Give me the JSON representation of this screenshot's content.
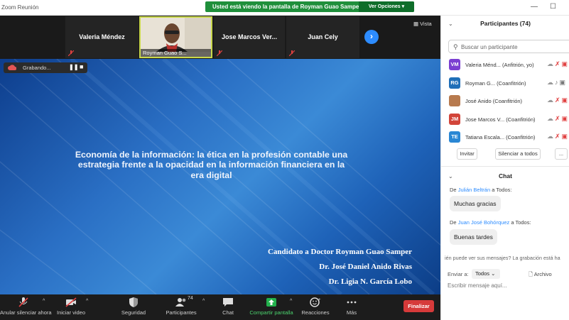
{
  "window": {
    "title": "Zoom Reunión",
    "share_banner": "Usted está viendo la pantalla de Royman Guao Samper",
    "view_options": "Ver Opciones",
    "minimize": "—",
    "maximize": "☐"
  },
  "gallery": {
    "tiles": [
      {
        "name": "Valeria Méndez"
      },
      {
        "name": "Royman Guao S..."
      },
      {
        "name": "Jose Marcos Ver..."
      },
      {
        "name": "Juan Cely"
      }
    ],
    "view_label": "Vista"
  },
  "recording": {
    "label": "Grabando..."
  },
  "slide": {
    "title_lines": [
      "Economía de la información: la ética en la profesión contable una",
      "estrategia frente a la opacidad en la información financiera en la",
      "era digital"
    ],
    "authors": [
      "Candidato a Doctor Royman Guao Samper",
      "Dr. José Daniel Anido Rivas",
      "Dr. Ligia N. García Lobo"
    ]
  },
  "toolbar": {
    "mute": "Anular silenciar ahora",
    "video": "Iniciar video",
    "security": "Seguridad",
    "participants": "Participantes",
    "participants_count": "74",
    "chat": "Chat",
    "share": "Compartir pantalla",
    "reactions": "Reacciones",
    "more": "Más",
    "end": "Finalizar"
  },
  "participants_panel": {
    "header": "Participantes (74)",
    "search_placeholder": "Buscar un participante",
    "people": [
      {
        "initials": "VM",
        "name": "Valeria Ménd...  (Anfitrión, yo)",
        "color": "#7b3fd1"
      },
      {
        "initials": "RG",
        "name": "Royman G...  (Coanfitrión)",
        "color": "#1f6fb8"
      },
      {
        "initials": "",
        "name": "José Anido  (Coanfitrión)",
        "color": "#b77a4e"
      },
      {
        "initials": "JM",
        "name": "Jose Marcos V...  (Coanfitrión)",
        "color": "#d2453a"
      },
      {
        "initials": "TE",
        "name": "Tatiana Escala...  (Coanfitrión)",
        "color": "#2a87d4"
      }
    ],
    "invite": "Invitar",
    "mute_all": "Silenciar a todos",
    "more": "..."
  },
  "chat_panel": {
    "header": "Chat",
    "messages": [
      {
        "from_prefix": "De",
        "sender": "Julián Beltrán",
        "to": "a Todos:",
        "text": "Muchas gracias"
      },
      {
        "from_prefix": "De",
        "sender": "Juan José Bohórquez",
        "to": "a Todos:",
        "text": "Buenas tardes"
      }
    ],
    "notice": "ién puede ver sus mensajes? La grabación está ha",
    "send_to_label": "Enviar a:",
    "send_to_value": "Todos",
    "file_label": "Archivo",
    "input_placeholder": "Escribir mensaje aquí..."
  }
}
